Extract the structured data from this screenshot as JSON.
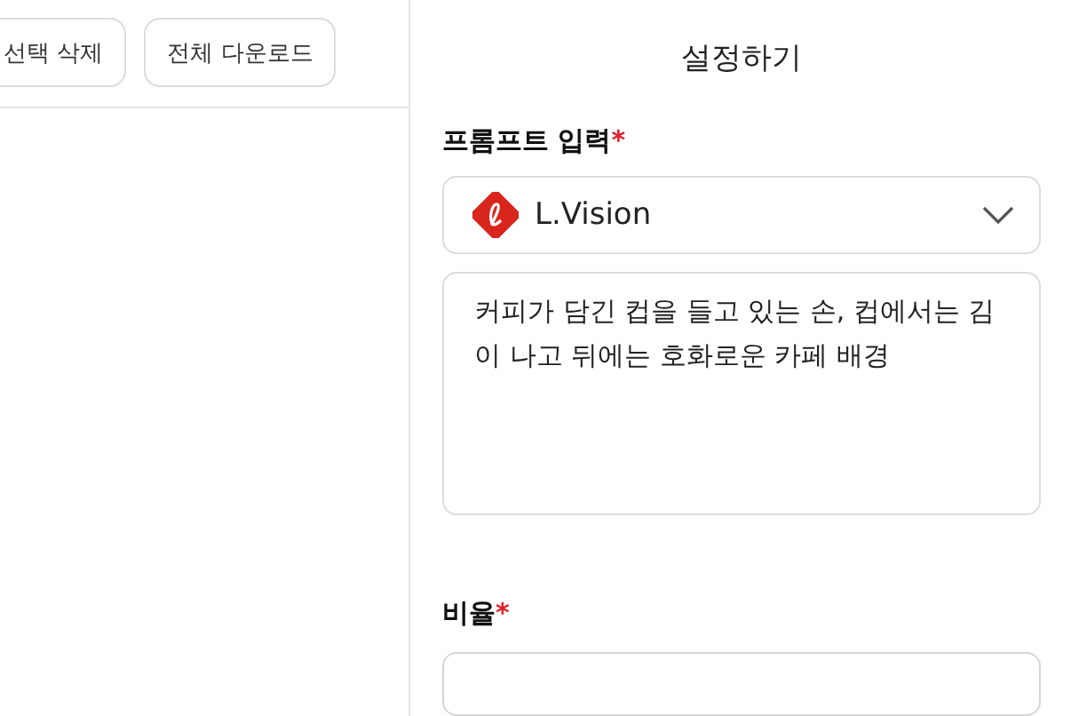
{
  "toolbar": {
    "buttons": [
      "선택 삭제",
      "전체 다운로드"
    ]
  },
  "settings": {
    "title": "설정하기",
    "prompt": {
      "label": "프롬프트 입력",
      "mark": "*",
      "model": "L.Vision",
      "value": "커피가 담긴 컵을 들고 있는 손, 컵에서는 김이 나고 뒤에는 호화로운 카페 배경"
    },
    "ratio": {
      "label": "비율",
      "mark": "*"
    }
  }
}
